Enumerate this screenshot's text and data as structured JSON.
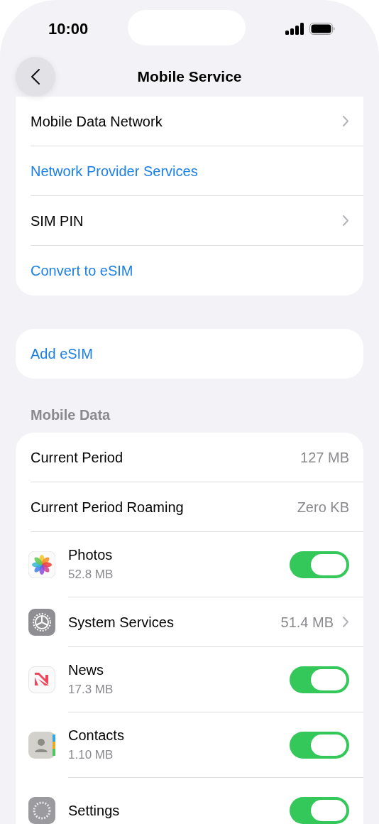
{
  "status_bar": {
    "time": "10:00"
  },
  "nav": {
    "title": "Mobile Service"
  },
  "groups": [
    {
      "items": [
        {
          "kind": "nav",
          "label": "Mobile Data Network"
        },
        {
          "kind": "action",
          "label": "Network Provider Services"
        },
        {
          "kind": "nav",
          "label": "SIM PIN"
        },
        {
          "kind": "action",
          "label": "Convert to eSIM"
        }
      ]
    },
    {
      "items": [
        {
          "kind": "action",
          "label": "Add eSIM"
        }
      ]
    },
    {
      "header": "Mobile Data",
      "items": [
        {
          "kind": "value",
          "label": "Current Period",
          "value": "127 MB"
        },
        {
          "kind": "value",
          "label": "Current Period Roaming",
          "value": "Zero KB"
        },
        {
          "kind": "app",
          "label": "Photos",
          "detail": "52.8 MB",
          "on": true
        },
        {
          "kind": "app_nav",
          "label": "System Services",
          "value": "51.4 MB"
        },
        {
          "kind": "app",
          "label": "News",
          "detail": "17.3 MB",
          "on": true
        },
        {
          "kind": "app",
          "label": "Contacts",
          "detail": "1.10 MB",
          "on": true
        },
        {
          "kind": "app",
          "label": "Settings",
          "on": true
        }
      ]
    }
  ]
}
